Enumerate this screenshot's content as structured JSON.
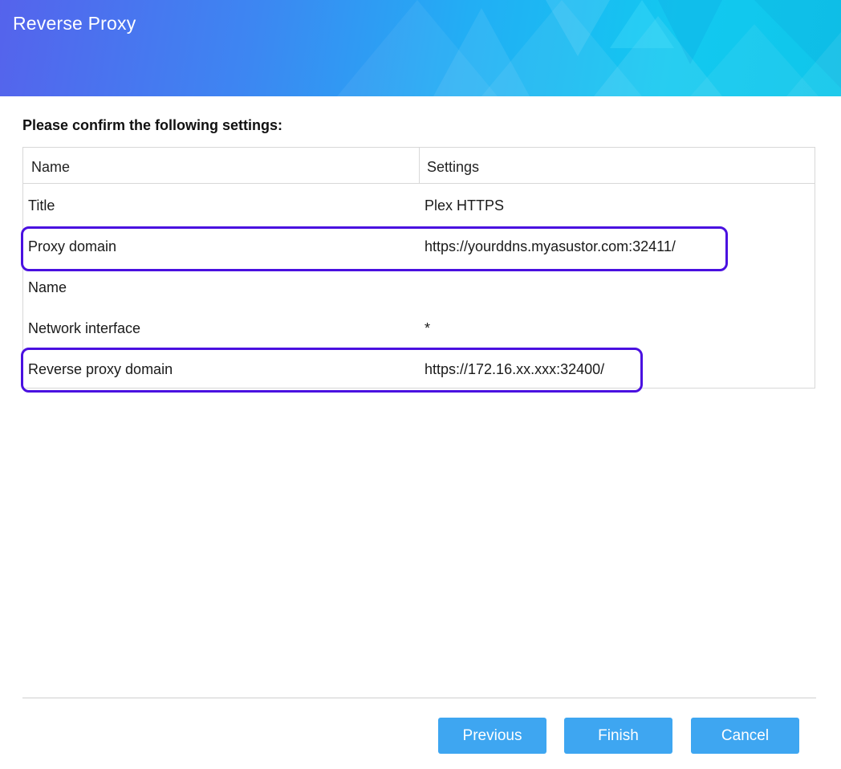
{
  "window": {
    "title": "Reverse Proxy"
  },
  "main": {
    "heading": "Please confirm the following settings:",
    "table": {
      "columns": [
        "Name",
        "Settings"
      ],
      "rows": [
        {
          "name": "Title",
          "value": "Plex HTTPS"
        },
        {
          "name": "Proxy domain",
          "value": "https://yourddns.myasustor.com:32411/"
        },
        {
          "name": "Name",
          "value": ""
        },
        {
          "name": "Network interface",
          "value": "*"
        },
        {
          "name": "Reverse proxy domain",
          "value": "https://172.16.xx.xxx:32400/"
        }
      ]
    }
  },
  "footer": {
    "previous_label": "Previous",
    "finish_label": "Finish",
    "cancel_label": "Cancel"
  },
  "colors": {
    "header_gradient_start": "#5563ec",
    "header_gradient_end": "#0fc6ea",
    "button": "#3ea6f1",
    "highlight_outline": "#4a10e0"
  }
}
